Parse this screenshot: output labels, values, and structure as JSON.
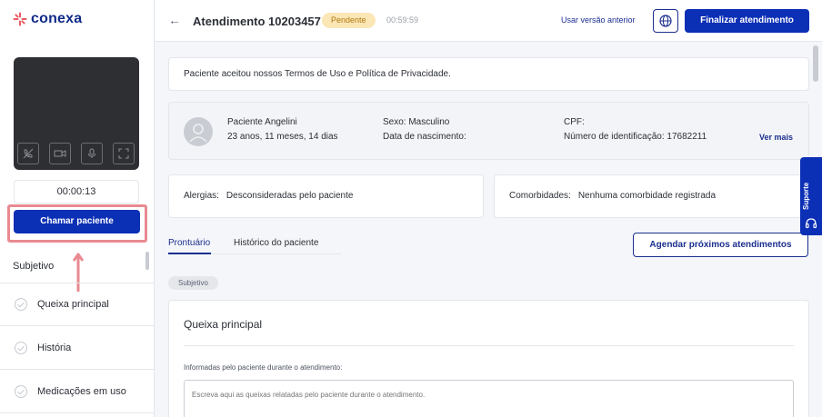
{
  "brand": {
    "name": "conexa",
    "accent": "#0b2fb5",
    "logo_color": "#e85a62"
  },
  "sidebar": {
    "call_timer": "00:00:13",
    "call_button_label": "Chamar paciente",
    "section_title": "Subjetivo",
    "items": [
      {
        "label": "Queixa principal",
        "icon": "check-circle-icon"
      },
      {
        "label": "História",
        "icon": "check-circle-icon"
      },
      {
        "label": "Medicações em uso",
        "icon": "check-circle-icon"
      }
    ],
    "video_controls": [
      "phone-icon",
      "camera-icon",
      "microphone-icon",
      "fullscreen-icon"
    ]
  },
  "header": {
    "title": "Atendimento 10203457",
    "status_badge": "Pendente",
    "elapsed": "00:59:59",
    "previous_version_link": "Usar versão anterior",
    "finish_button": "Finalizar atendimento"
  },
  "terms_notice": "Paciente aceitou nossos Termos de Uso e Política de Privacidade.",
  "patient": {
    "name": "Paciente Angelini",
    "age": "23 anos, 11 meses, 14 dias",
    "sex": "Sexo: Masculino",
    "birth_date_label": "Data de nascimento:",
    "cpf_label": "CPF:",
    "id_label": "Número de identificação: 17682211",
    "more_link": "Ver mais"
  },
  "allergies": {
    "label": "Alergias:",
    "value": "Desconsideradas pelo paciente"
  },
  "comorbidities": {
    "label": "Comorbidades:",
    "value": "Nenhuma comorbidade registrada"
  },
  "tabs": [
    {
      "label": "Prontuário",
      "active": true
    },
    {
      "label": "Histórico do paciente",
      "active": false
    }
  ],
  "schedule_button": "Agendar próximos atendimentos",
  "section_chip": "Subjetivo",
  "complaint": {
    "title": "Queixa principal",
    "field_label": "Informadas pelo paciente durante o atendimento:",
    "placeholder": "Escreva aqui as queixas relatadas pelo paciente durante o atendimento."
  },
  "support_tab": "Suporte"
}
